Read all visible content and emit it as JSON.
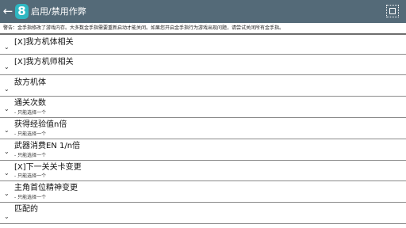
{
  "toolbar": {
    "title": "启用/禁用作弊",
    "back_icon": "back-arrow-icon",
    "app_icon": "8",
    "fullscreen_icon": "fullscreen-icon",
    "bar_color": "#546a78",
    "app_icon_color": "#2fb7c2"
  },
  "warning": "警告：金手指修改了游戏内存。大多数金手指需要重新启动才能关闭。如果您开启金手指行为游戏出现问题，请尝试关闭所有金手指。",
  "cheats": [
    {
      "label": "[X]我方机体相关",
      "sub": ""
    },
    {
      "label": "[X]我方机师相关",
      "sub": ""
    },
    {
      "label": "敌方机体",
      "sub": ""
    },
    {
      "label": "通关次数",
      "sub": "- 只能选择一个"
    },
    {
      "label": "获得经验值n倍",
      "sub": "- 只能选择一个"
    },
    {
      "label": "武器消费EN 1/n倍",
      "sub": "- 只能选择一个"
    },
    {
      "label": "[X]下一关关卡变更",
      "sub": "- 只能选择一个"
    },
    {
      "label": "主角首位精神变更",
      "sub": "- 只能选择一个"
    },
    {
      "label": "匹配的",
      "sub": ""
    }
  ]
}
